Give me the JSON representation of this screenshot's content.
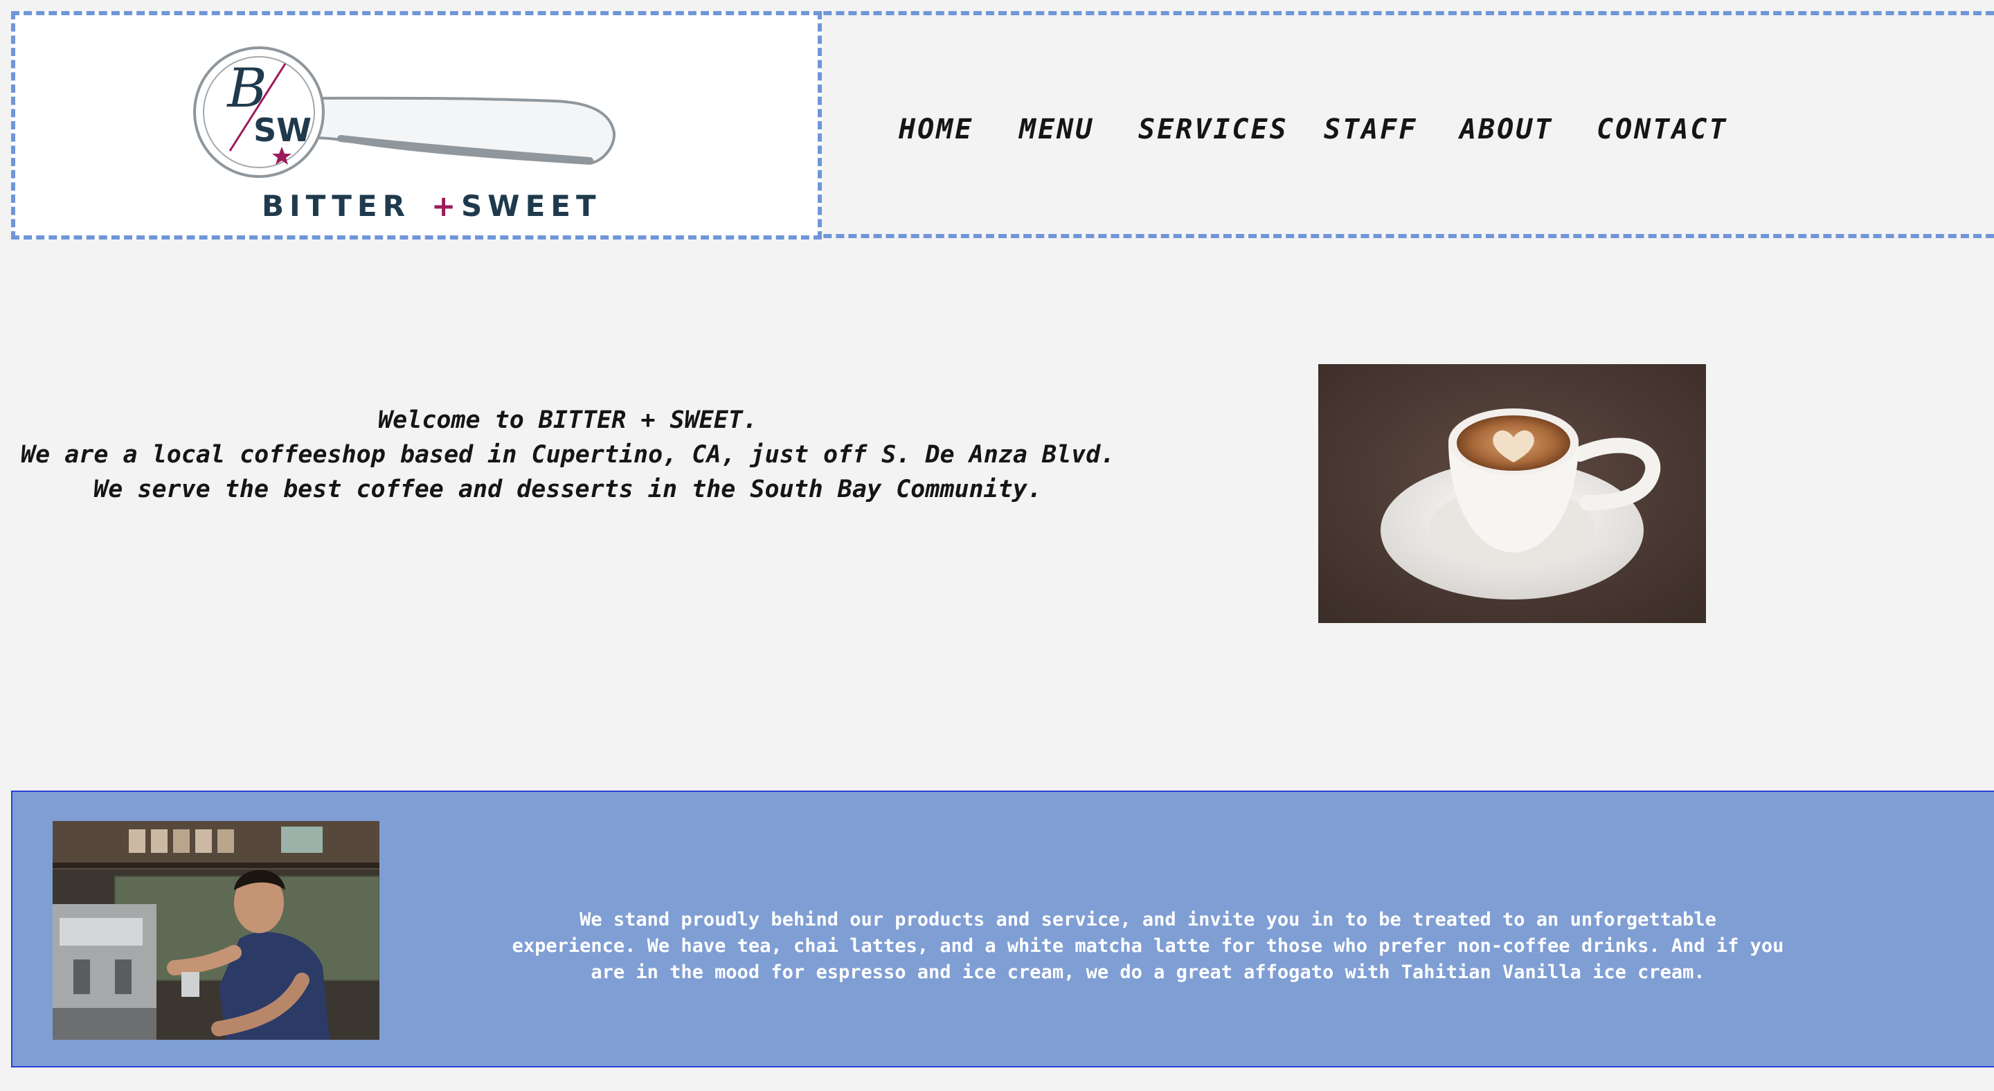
{
  "logo": {
    "monogram_top": "B",
    "monogram_bottom": "SW",
    "wordmark_left": "BITTER",
    "wordmark_plus": "+",
    "wordmark_right": "SWEET"
  },
  "nav": {
    "items": [
      {
        "label": "HOME"
      },
      {
        "label": "MENU"
      },
      {
        "label": "SERVICES"
      },
      {
        "label": "STAFF"
      },
      {
        "label": "ABOUT"
      },
      {
        "label": "CONTACT"
      }
    ]
  },
  "hero": {
    "lines": [
      "Welcome to BITTER + SWEET.",
      "We are a local coffeeshop based in Cupertino, CA, just off S. De Anza Blvd.",
      "We serve the best coffee and desserts in the South Bay Community."
    ]
  },
  "about_band": {
    "lines": [
      "We stand proudly behind our products and service, and invite you in to be treated to an unforgettable",
      "experience. We have tea, chai lattes, and a white matcha latte for those who prefer non-coffee drinks. And if you",
      "are in the mood for espresso and ice cream, we do a great affogato with Tahitian Vanilla ice cream."
    ]
  },
  "colors": {
    "page_bg": "#f3f3f3",
    "header_border": "#6f96d8",
    "band_bg": "#7f9ed3",
    "band_border": "#2a3fd6",
    "logo_navy": "#1f3a4d",
    "logo_accent": "#9c1a5a"
  }
}
